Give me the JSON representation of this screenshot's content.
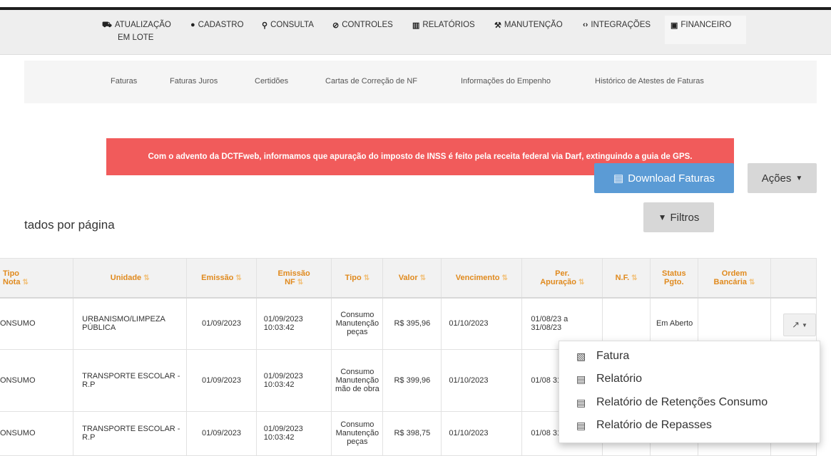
{
  "nav": {
    "items": [
      {
        "icon": "car-icon",
        "glyph": "⛟",
        "label": "Atualização"
      },
      {
        "icon": "user-icon",
        "glyph": "●",
        "label": "Cadastro"
      },
      {
        "icon": "search-icon",
        "glyph": "⚲",
        "label": "Consulta"
      },
      {
        "icon": "ban-icon",
        "glyph": "⊘",
        "label": "Controles"
      },
      {
        "icon": "chart-icon",
        "glyph": "▥",
        "label": "Relatórios"
      },
      {
        "icon": "wrench-icon",
        "glyph": "⚒",
        "label": "Manutenção"
      },
      {
        "icon": "code-icon",
        "glyph": "‹›",
        "label": "Integrações"
      },
      {
        "icon": "money-icon",
        "glyph": "▣",
        "label": "Financeiro"
      }
    ],
    "lote_label": "EM LOTE"
  },
  "subnav": [
    "Faturas",
    "Faturas Juros",
    "Certidões",
    "Cartas de Correção de NF",
    "Informações do Empenho",
    "Histórico de Atestes de Faturas"
  ],
  "alert": "Com o advento da DCTFweb, informamos que apuração do imposto de INSS é feito pela receita federal via Darf, extinguindo a guia de GPS.",
  "buttons": {
    "download": "Download Faturas",
    "acoes": "Ações",
    "filtros": "Filtros"
  },
  "perpage_text": "tados por página",
  "table": {
    "headers": [
      {
        "l1": "Tipo",
        "l2": "Nota"
      },
      {
        "l1": "Unidade",
        "l2": ""
      },
      {
        "l1": "Emissão",
        "l2": ""
      },
      {
        "l1": "Emissão",
        "l2": "NF"
      },
      {
        "l1": "Tipo",
        "l2": ""
      },
      {
        "l1": "Valor",
        "l2": ""
      },
      {
        "l1": "Vencimento",
        "l2": ""
      },
      {
        "l1": "Per.",
        "l2": "Apuração"
      },
      {
        "l1": "N.F.",
        "l2": ""
      },
      {
        "l1": "Status",
        "l2": "Pgto."
      },
      {
        "l1": "Ordem",
        "l2": "Bancária"
      },
      {
        "l1": "",
        "l2": ""
      }
    ],
    "rows": [
      {
        "tipo_nota": "ONSUMO",
        "unidade": "URBANISMO/LIMPEZA PÚBLICA",
        "emissao": "01/09/2023",
        "emissao_nf": "01/09/2023 10:03:42",
        "tipo": "Consumo Manutenção peças",
        "valor": "R$ 395,96",
        "vencimento": "01/10/2023",
        "periodo": "01/08/23 a 31/08/23",
        "nf": "",
        "status": "Em Aberto",
        "ordem": ""
      },
      {
        "tipo_nota": "ONSUMO",
        "unidade": "TRANSPORTE ESCOLAR - R.P",
        "emissao": "01/09/2023",
        "emissao_nf": "01/09/2023 10:03:42",
        "tipo": "Consumo Manutenção mão de obra",
        "valor": "R$ 399,96",
        "vencimento": "01/10/2023",
        "periodo": "01/08 31/08",
        "nf": "",
        "status": "",
        "ordem": ""
      },
      {
        "tipo_nota": "ONSUMO",
        "unidade": "TRANSPORTE ESCOLAR - R.P",
        "emissao": "01/09/2023",
        "emissao_nf": "01/09/2023 10:03:42",
        "tipo": "Consumo Manutenção peças",
        "valor": "R$ 398,75",
        "vencimento": "01/10/2023",
        "periodo": "01/08 31/08",
        "nf": "",
        "status": "",
        "ordem": ""
      }
    ]
  },
  "dropdown": [
    {
      "icon": "pdf-file-icon",
      "label": "Fatura"
    },
    {
      "icon": "file-icon",
      "label": "Relatório"
    },
    {
      "icon": "file-icon",
      "label": "Relatório de Retenções Consumo"
    },
    {
      "icon": "file-icon",
      "label": "Relatório de Repasses"
    }
  ]
}
